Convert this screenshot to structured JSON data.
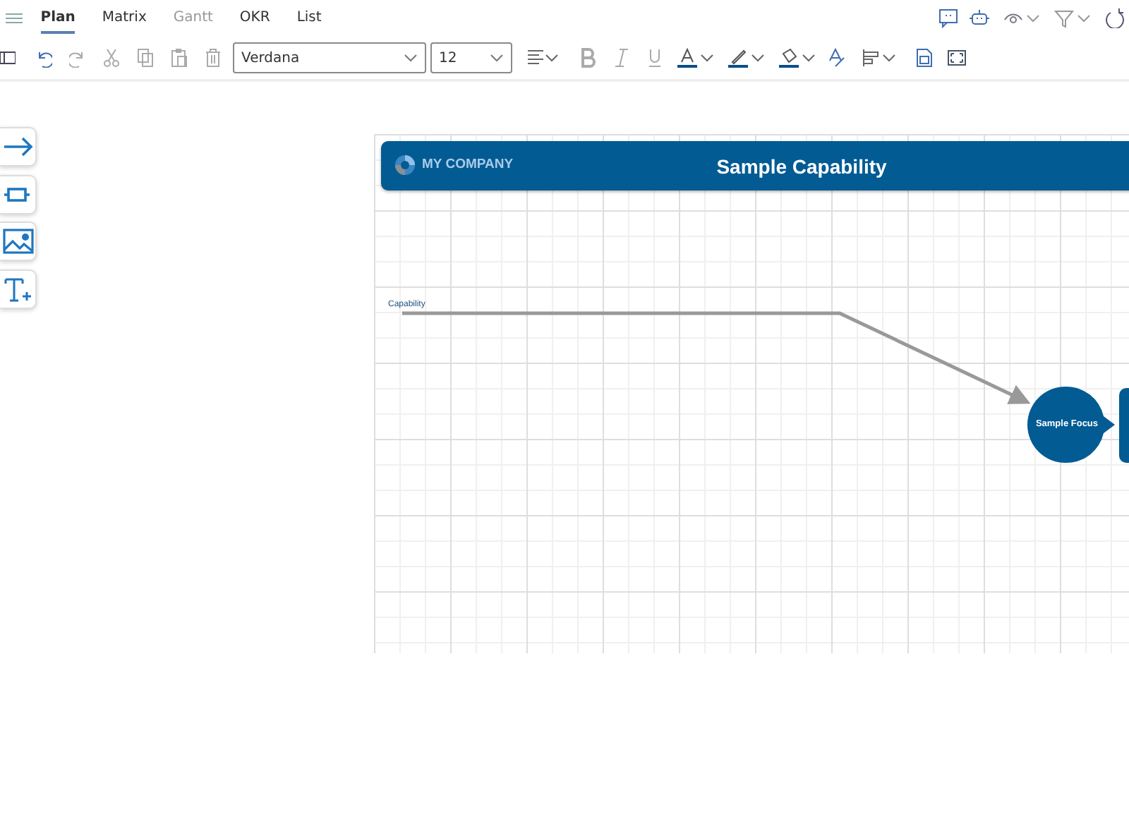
{
  "tabs": [
    {
      "label": "Plan",
      "selected": true,
      "disabled": false
    },
    {
      "label": "Matrix",
      "selected": false,
      "disabled": false
    },
    {
      "label": "Gantt",
      "selected": false,
      "disabled": true
    },
    {
      "label": "OKR",
      "selected": false,
      "disabled": false
    },
    {
      "label": "List",
      "selected": false,
      "disabled": false
    }
  ],
  "toolbar": {
    "font": "Verdana",
    "font_size": "12"
  },
  "diagram": {
    "company": "MY COMPANY",
    "title": "Sample Capability",
    "lane_label": "Capability",
    "focus_node": "Sample Focus"
  }
}
